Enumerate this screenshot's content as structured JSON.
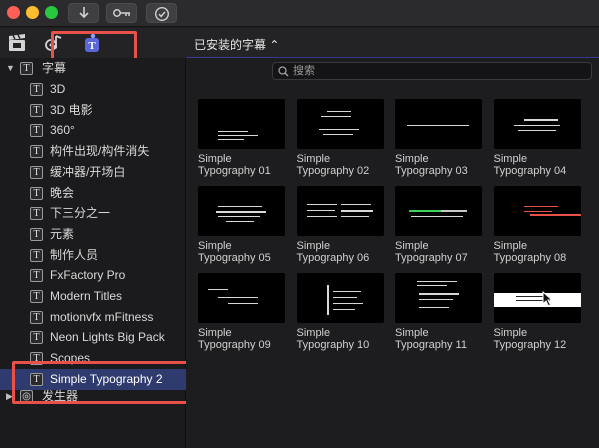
{
  "toolbar": {
    "download_icon": "download-icon",
    "keys_icon": "key-icon",
    "check_icon": "checkmark-icon"
  },
  "browser": {
    "title": "已安装的字幕 ⌃",
    "search_placeholder": "搜索"
  },
  "sidebar": {
    "group_titles": "字幕",
    "group_generators": "发生器",
    "items": [
      "3D",
      "3D 电影",
      "360°",
      "构件出现/构件消失",
      "缓冲器/开场白",
      "晚会",
      "下三分之一",
      "元素",
      "制作人员",
      "FxFactory Pro",
      "Modern Titles",
      "motionvfx mFitness",
      "Neon Lights Big Pack",
      "Scopes",
      "Simple Typography 2"
    ],
    "selected_index": 14
  },
  "clips": [
    {
      "line1": "Simple",
      "line2": "Typography 01"
    },
    {
      "line1": "Simple",
      "line2": "Typography 02"
    },
    {
      "line1": "Simple",
      "line2": "Typography 03"
    },
    {
      "line1": "Simple",
      "line2": "Typography 04"
    },
    {
      "line1": "Simple",
      "line2": "Typography 05"
    },
    {
      "line1": "Simple",
      "line2": "Typography 06"
    },
    {
      "line1": "Simple",
      "line2": "Typography 07"
    },
    {
      "line1": "Simple",
      "line2": "Typography 08"
    },
    {
      "line1": "Simple",
      "line2": "Typography 09"
    },
    {
      "line1": "Simple",
      "line2": "Typography 10"
    },
    {
      "line1": "Simple",
      "line2": "Typography 11"
    },
    {
      "line1": "Simple",
      "line2": "Typography 12"
    }
  ],
  "colors": {
    "highlight_red": "#e8514a",
    "selection_blue": "#2f3b6e"
  }
}
